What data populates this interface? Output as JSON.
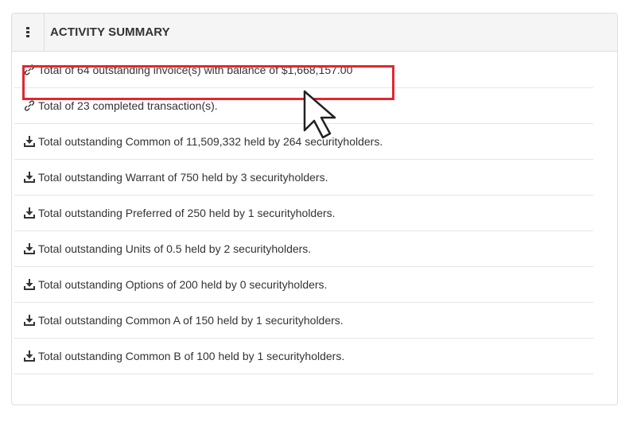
{
  "panel": {
    "title": "ACTIVITY SUMMARY",
    "menu_icon": "kebab-menu-icon"
  },
  "items": [
    {
      "icon": "link-icon",
      "text": "Total of 64 outstanding invoice(s) with balance of $1,668,157.00",
      "highlighted": true
    },
    {
      "icon": "link-icon",
      "text": "Total of 23 completed transaction(s)."
    },
    {
      "icon": "download-icon",
      "text": "Total outstanding Common of 11,509,332 held by 264 securityholders."
    },
    {
      "icon": "download-icon",
      "text": "Total outstanding Warrant of 750 held by 3 securityholders."
    },
    {
      "icon": "download-icon",
      "text": "Total outstanding Preferred of 250 held by 1 securityholders."
    },
    {
      "icon": "download-icon",
      "text": "Total outstanding Units of 0.5 held by 2 securityholders."
    },
    {
      "icon": "download-icon",
      "text": "Total outstanding Options of 200 held by 0 securityholders."
    },
    {
      "icon": "download-icon",
      "text": "Total outstanding Common A of 150 held by 1 securityholders."
    },
    {
      "icon": "download-icon",
      "text": "Total outstanding Common B of 100 held by 1 securityholders."
    }
  ],
  "colors": {
    "highlight_border": "#e3262f",
    "header_bg": "#f5f5f5",
    "text": "#333333",
    "divider": "#e5e5e5"
  }
}
